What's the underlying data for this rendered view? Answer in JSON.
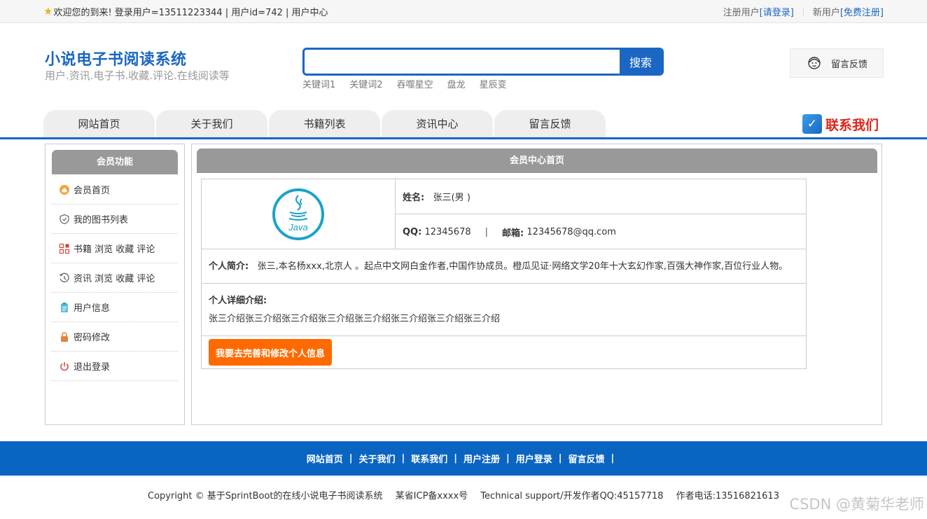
{
  "topbar": {
    "welcome": "欢迎您的到来!  登录用户=13511223344 | 用户id=742 | 用户中心",
    "registered_label": "注册用户",
    "login_link": "[请登录]",
    "new_user_label": "新用户",
    "register_link": "[免费注册]"
  },
  "header": {
    "title": "小说电子书阅读系统",
    "subtitle": "用户.资讯.电子书.收藏.评论.在线阅读等",
    "search_button": "搜索",
    "search_value": "",
    "keywords": [
      "关键词1",
      "关键词2",
      "吞噬星空",
      "盘龙",
      "星辰变"
    ],
    "feedback": "留言反馈",
    "contact": "联系我们"
  },
  "nav": [
    "网站首页",
    "关于我们",
    "书籍列表",
    "资讯中心",
    "留言反馈"
  ],
  "sidebar": {
    "title": "会员功能",
    "items": [
      {
        "label": "会员首页",
        "icon": "home-icon"
      },
      {
        "label": "我的图书列表",
        "icon": "shield-icon"
      },
      {
        "label": "书籍 浏览 收藏 评论",
        "icon": "grid-icon"
      },
      {
        "label": "资讯 浏览 收藏 评论",
        "icon": "history-icon"
      },
      {
        "label": "用户信息",
        "icon": "clipboard-icon"
      },
      {
        "label": "密码修改",
        "icon": "lock-icon"
      },
      {
        "label": "退出登录",
        "icon": "power-icon"
      }
    ]
  },
  "main": {
    "title": "会员中心首页",
    "photo_text": "Java",
    "name_label": "姓名:",
    "name_value": "张三(男 )",
    "qq_label": "QQ:",
    "qq_value": "12345678",
    "email_label": "邮箱:",
    "email_value": "12345678@qq.com",
    "intro_label": "个人简介:",
    "intro_text": "张三,本名杨xxx,北京人 。起点中文网白金作者,中国作协成员。橙瓜见证·网络文学20年十大玄幻作家,百强大神作家,百位行业人物。",
    "detail_label": "个人详细介绍:",
    "detail_text": "张三介绍张三介绍张三介绍张三介绍张三介绍张三介绍张三介绍张三介绍",
    "edit_button": "我要去完善和修改个人信息"
  },
  "footer": {
    "links": [
      "网站首页",
      "关于我们",
      "联系我们",
      "用户注册",
      "用户登录",
      "留言反馈"
    ],
    "copyright": "Copyright © 基于SprintBoot的在线小说电子书阅读系统",
    "icp": "某省ICP备xxxx号",
    "support": "Technical support/开发作者QQ:45157718",
    "phone": "作者电话:13516821613",
    "watermark": "CSDN @黄菊华老师"
  },
  "colors": {
    "brand": "#1a66c2",
    "accent": "#ff6a00",
    "contact": "#d9261c"
  }
}
